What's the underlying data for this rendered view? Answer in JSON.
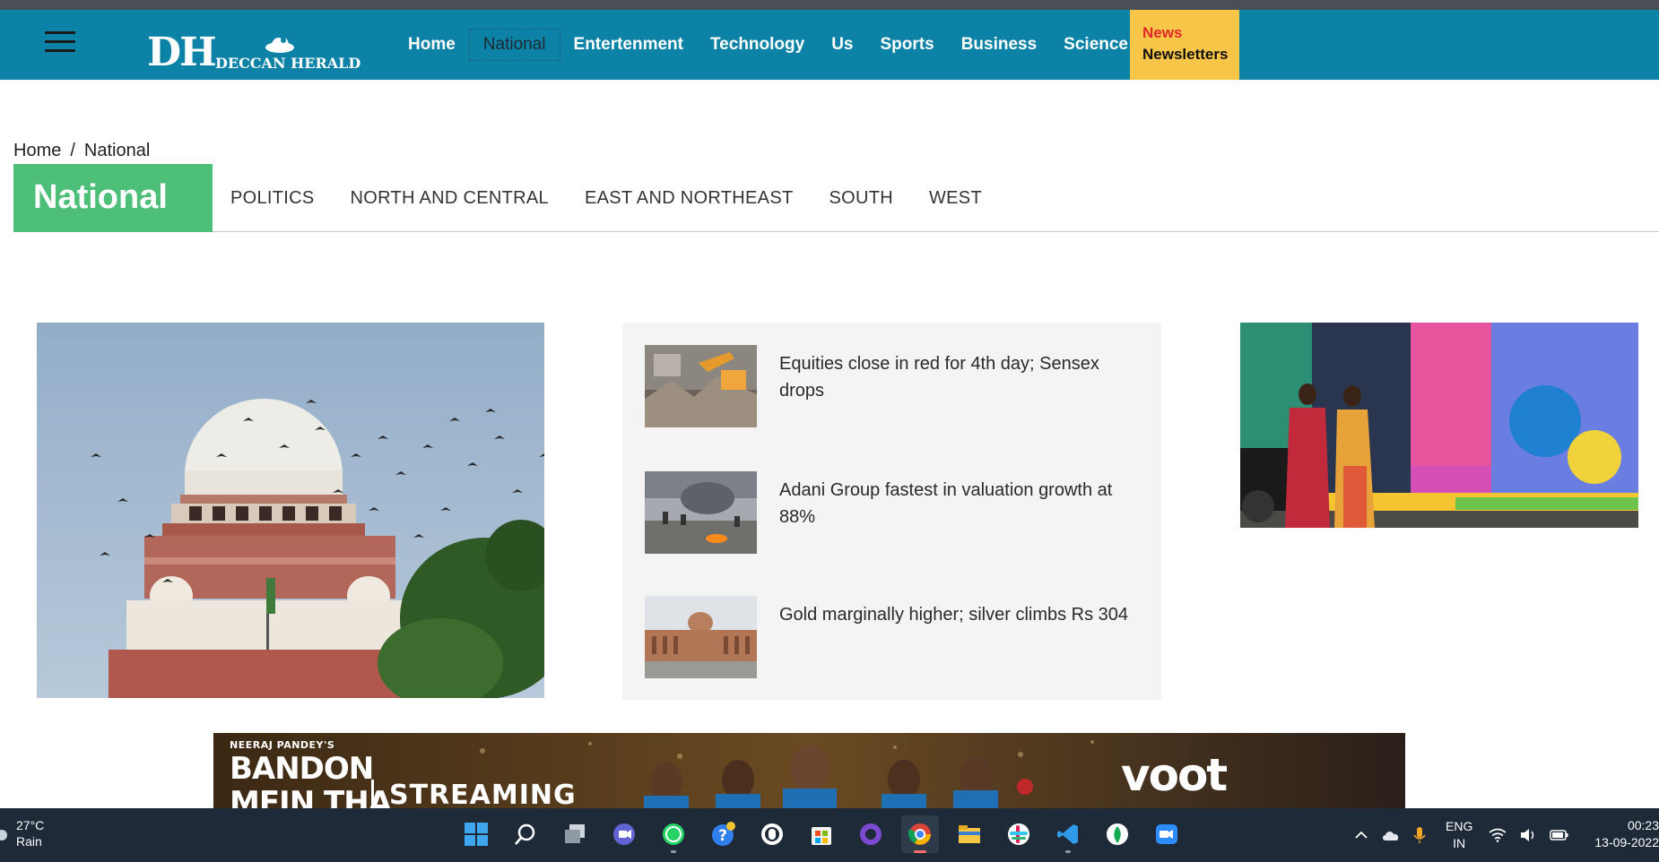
{
  "header": {
    "logo_initials": "DH",
    "logo_name": "DECCAN HERALD",
    "nav": [
      {
        "label": "Home"
      },
      {
        "label": "National"
      },
      {
        "label": "Entertenment"
      },
      {
        "label": "Technology"
      },
      {
        "label": "Us"
      },
      {
        "label": "Sports"
      },
      {
        "label": "Business"
      },
      {
        "label": "Science"
      }
    ],
    "newsletter_accent": "News",
    "newsletter_label": "Newsletters"
  },
  "breadcrumb": {
    "home": "Home",
    "separator": "/",
    "current": "National"
  },
  "section": {
    "title": "National",
    "subnav": [
      "POLITICS",
      "NORTH AND CENTRAL",
      "EAST AND NORTHEAST",
      "SOUTH",
      "WEST"
    ]
  },
  "stories": [
    {
      "headline": "Equities close in red for 4th day; Sensex drops"
    },
    {
      "headline": "Adani Group fastest in valuation growth at 88%"
    },
    {
      "headline": "Gold marginally higher; silver climbs Rs 304"
    }
  ],
  "ad": {
    "presenter": "NEERAJ PANDEY'S",
    "title_line1": "BANDON",
    "title_line2": "MEIN THA",
    "streaming": "STREAMING",
    "brand": "voot"
  },
  "taskbar": {
    "weather_temp": "27°C",
    "weather_desc": "Rain",
    "lang_top": "ENG",
    "lang_bottom": "IN",
    "time": "00:23",
    "date": "13-09-2022"
  },
  "colors": {
    "header_bg": "#0c83a6",
    "section_green": "#4dbf78",
    "newsletter_bg": "#f7c548",
    "news_red": "#e3262b",
    "taskbar_bg": "#1e2a38"
  }
}
